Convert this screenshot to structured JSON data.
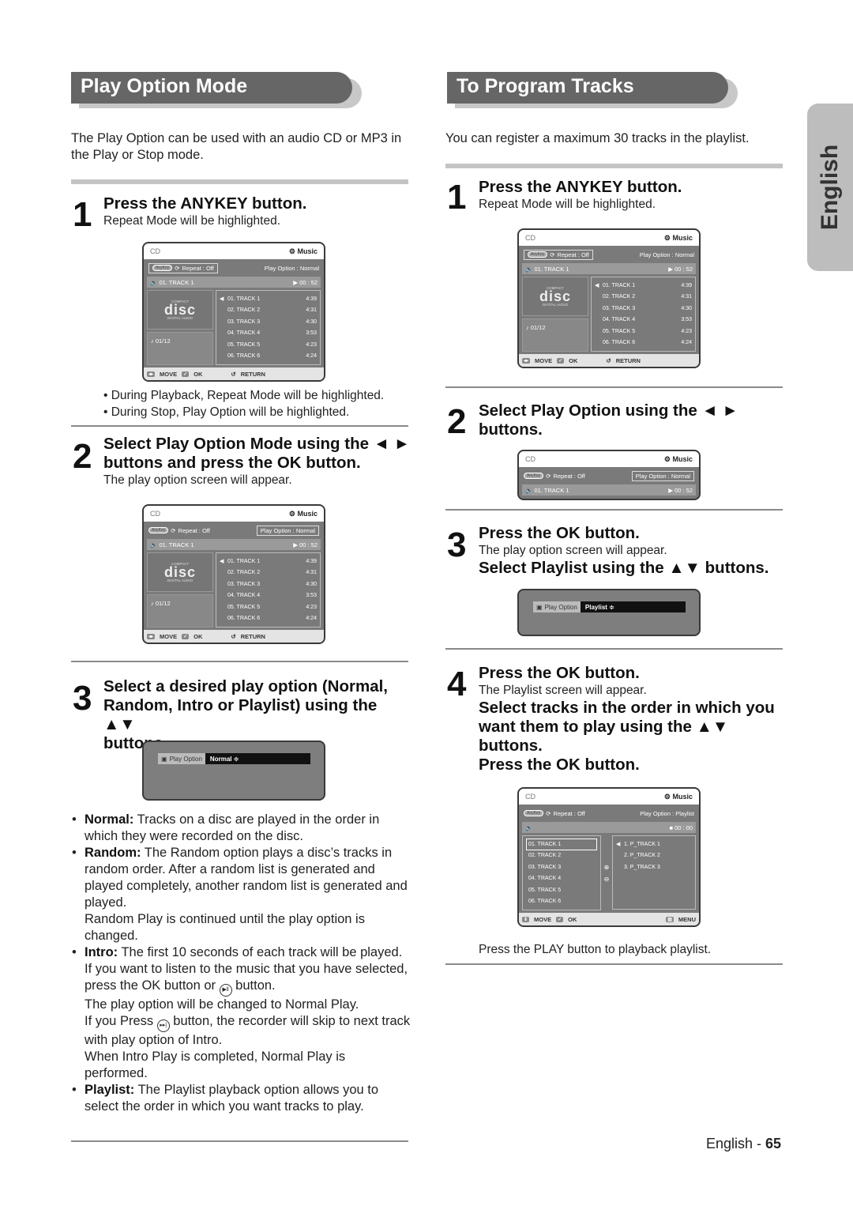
{
  "side_tab": {
    "label": "English"
  },
  "left": {
    "title": "Play Option Mode",
    "intro": "The Play Option can be used with an audio CD or MP3 in the Play or Stop mode.",
    "step1": {
      "num": "1",
      "head": "Press the ANYKEY button.",
      "sub": "Repeat Mode will be highlighted."
    },
    "notes": [
      "• During Playback, Repeat Mode will be highlighted.",
      "• During Stop, Play Option will be highlighted."
    ],
    "step2": {
      "num": "2",
      "head1": "Select Play Option Mode using the ◄ ►",
      "head2": "buttons and press the OK button.",
      "sub": "The play option screen will appear."
    },
    "step3": {
      "num": "3",
      "head1": "Select a desired play option (Normal,",
      "head2": "Random, Intro or Playlist) using the ▲▼",
      "head3": "buttons."
    },
    "option_screen": {
      "label": "Play Option",
      "value": "Normal ≑"
    },
    "bullets": {
      "normal_term": "Normal:",
      "normal_text": " Tracks on a disc are played in the order in which they were recorded on the disc.",
      "random_term": "Random:",
      "random_text": " The Random option plays a disc’s tracks in random order. After a random list is generated and played completely, another random list is generated and played.",
      "random_extra": "Random Play is continued until the play option is changed.",
      "intro_term": "Intro:",
      "intro_text": " The first 10 seconds of each track will be played.",
      "intro_extra1a": "If you want to listen to the music that you have selected, press the OK button or ",
      "intro_extra1b": " button.",
      "intro_extra2": "The play option will be changed to Normal Play.",
      "intro_extra3a": "If you Press ",
      "intro_extra3b": " button, the recorder will skip to next track with play option of Intro.",
      "intro_extra4": "When Intro Play is completed, Normal Play is performed.",
      "playlist_term": "Playlist:",
      "playlist_text": " The Playlist playback option allows you to select the order in which you want tracks to play."
    }
  },
  "right": {
    "title": "To Program Tracks",
    "intro": "You can register a maximum 30 tracks in the playlist.",
    "step1": {
      "num": "1",
      "head": "Press the ANYKEY button.",
      "sub": "Repeat Mode will be highlighted."
    },
    "step2": {
      "num": "2",
      "head1": "Select Play Option using the ◄ ►",
      "head2": "buttons."
    },
    "step3": {
      "num": "3",
      "head": "Press the OK button.",
      "sub": "The play option screen will appear.",
      "head2": "Select Playlist using the ▲▼ buttons."
    },
    "option_screen": {
      "label": "Play Option",
      "value": "Playlist ≑"
    },
    "step4": {
      "num": "4",
      "head": "Press the OK button.",
      "sub": "The Playlist screen will appear.",
      "head2": "Select tracks in the order in which you want them to play using the ▲▼ buttons.",
      "head3": "Press the OK button."
    },
    "footer_note": "Press the PLAY button to playback playlist."
  },
  "osd": {
    "source": "CD",
    "mode": "⚙ Music",
    "anykey": "AnyKey",
    "repeat": "Repeat : Off",
    "play_option_normal": "Play Option : Normal",
    "play_option_playlist": "Play Option : Playlist",
    "now_track": "01. TRACK 1",
    "time_play": "00 : 52",
    "time_stop": "00 : 00",
    "disc_logo": "disc",
    "disc_top": "COMPACT",
    "disc_bottom": "DIGITAL AUDIO",
    "count": "01/12",
    "tracks": [
      {
        "name": "01. TRACK 1",
        "time": "4:39"
      },
      {
        "name": "02. TRACK 2",
        "time": "4:31"
      },
      {
        "name": "03. TRACK 3",
        "time": "4:30"
      },
      {
        "name": "04. TRACK 4",
        "time": "3:53"
      },
      {
        "name": "05. TRACK 5",
        "time": "4:23"
      },
      {
        "name": "06. TRACK 6",
        "time": "4:24"
      }
    ],
    "playlist": [
      "1. P_TRACK 1",
      "2. P_TRACK 2",
      "3. P_TRACK 3"
    ],
    "btn_move": "MOVE",
    "btn_ok": "OK",
    "btn_return": "RETURN",
    "btn_menu": "MENU"
  },
  "footer": {
    "lang": "English - ",
    "page": "65"
  }
}
